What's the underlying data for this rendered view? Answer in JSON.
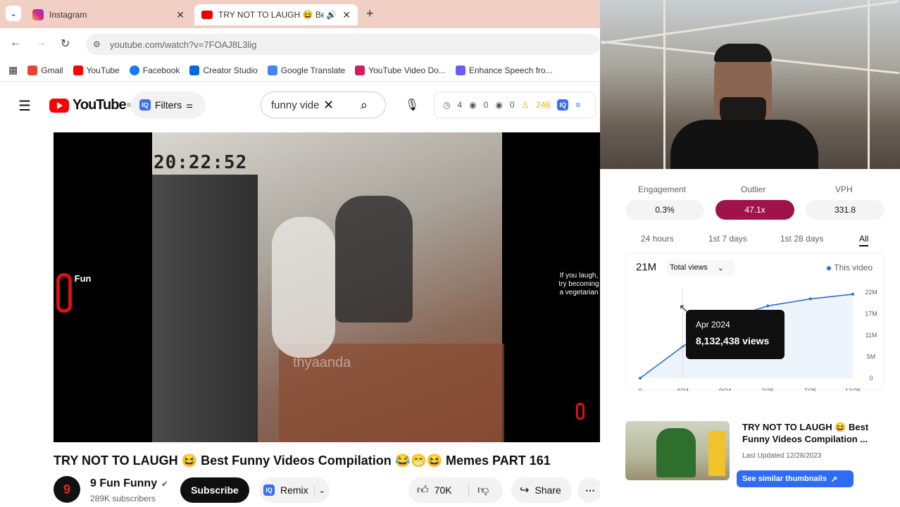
{
  "browser": {
    "tabs": [
      {
        "title": "Instagram"
      },
      {
        "title": "TRY NOT TO LAUGH 😆 Be"
      }
    ],
    "url": "youtube.com/watch?v=7FOAJ8L3lig",
    "bookmarks": [
      "Gmail",
      "YouTube",
      "Facebook",
      "Creator Studio",
      "Google Translate",
      "YouTube Video Do...",
      "Enhance Speech fro..."
    ]
  },
  "youtube": {
    "logo_text": "YouTube",
    "logo_region": "BD",
    "filters_label": "Filters",
    "search_value": "funny vide",
    "stats": {
      "watch": "4",
      "views": "0",
      "eye2": "0",
      "score": "246"
    }
  },
  "video": {
    "timestamp": "20:22:52",
    "channel_watermark": "Fun",
    "side_text": "If you laugh, try becoming a vegetarian",
    "blur_text": "thyaanda",
    "title": "TRY NOT TO LAUGH 😆 Best Funny Videos Compilation 😂😁😆 Memes PART 161"
  },
  "owner": {
    "avatar_text": "9",
    "channel_name": "9 Fun Funny",
    "subscribers": "289K subscribers",
    "subscribe_label": "Subscribe",
    "remix_label": "Remix",
    "likes": "70K",
    "share_label": "Share"
  },
  "panel": {
    "metrics": [
      {
        "label": "Engagement",
        "value": "0.3%"
      },
      {
        "label": "Outlier",
        "value": "47.1x"
      },
      {
        "label": "VPH",
        "value": "331.8"
      }
    ],
    "periods": [
      "24 hours",
      "1st 7 days",
      "1st 28 days",
      "All"
    ],
    "active_period": "All",
    "total": "21M",
    "metric_select": "Total views",
    "legend": "This video",
    "tooltip": {
      "date": "Apr 2024",
      "views": "8,132,438 views"
    },
    "colors": {
      "outlier": "#a0134a",
      "line": "#2a6fdb",
      "tooltip": "#0f0f0f"
    }
  },
  "chart_data": {
    "type": "line",
    "x": [
      "0",
      "4/24",
      "9/24",
      "2/25",
      "7/25",
      "12/25"
    ],
    "series": [
      {
        "values": [
          0,
          8.1,
          15,
          18.5,
          20.3,
          21.5
        ]
      }
    ],
    "y_ticks": [
      "22M",
      "17M",
      "11M",
      "5M",
      "0"
    ],
    "ylim": [
      0,
      22
    ],
    "grid": false
  },
  "recommendation": {
    "title": "TRY NOT TO LAUGH 😆 Best Funny Videos Compilation ...",
    "updated": "Last Updated 12/28/2023",
    "button": "See similar thumbnails"
  }
}
